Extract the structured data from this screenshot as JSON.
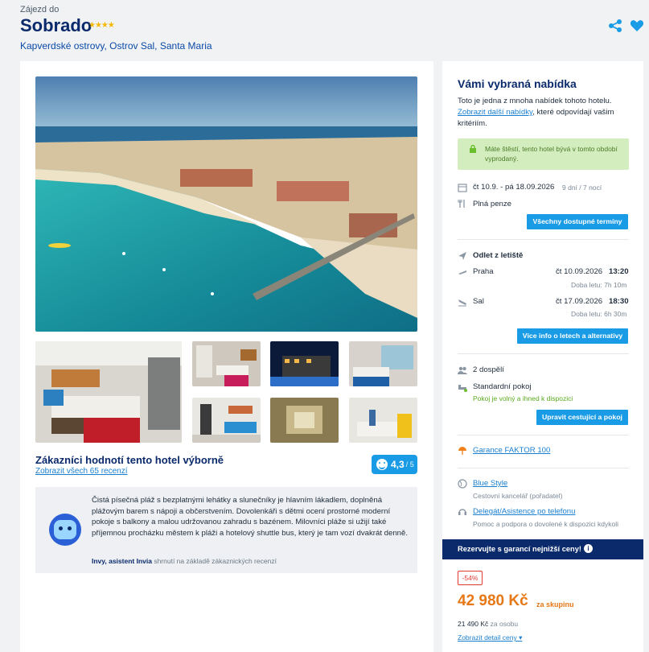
{
  "header": {
    "pretitle": "Zájezd do",
    "hotel_name": "Sobrado",
    "stars": "★★★★",
    "location": "Kapverdské ostrovy, Ostrov Sal, Santa Maria",
    "share_icon": "share-icon",
    "favorite_icon": "heart-icon"
  },
  "gallery": {
    "main_image": "beach-resort-aerial-photo",
    "thumbnails": [
      "hotel-room",
      "room-interior",
      "hotel-night",
      "room-view",
      "room-balcony",
      "bedroom",
      "bathroom",
      "reception"
    ]
  },
  "rating": {
    "title": "Zákazníci hodnotí tento hotel výborně",
    "link": "Zobrazit všech 65 recenzí",
    "value": "4,3",
    "max": "/ 5"
  },
  "ai_summary": {
    "text": "Čistá písečná pláž s bezplatnými lehátky a slunečníky je hlavním lákadlem, doplněná plážovým barem s nápoji a občerstvením. Dovolenkáři s dětmi ocení prostorné moderní pokoje s balkony a malou udržovanou zahradu s bazénem. Milovníci pláže si užijí také příjemnou procházku městem k pláži a hotelový shuttle bus, který je tam vozí dvakrát denně.",
    "author": "Invy, asistent Invia",
    "author_note": " shrnutí na základě zákaznických recenzí"
  },
  "offer": {
    "title": "Vámi vybraná nabídka",
    "desc_1": "Toto je jedna z mnoha nabídek tohoto hotelu.",
    "desc_link": "Zobrazit další nabídky",
    "desc_2": ", které odpovídají vašim kritériím.",
    "alert": "Máte štěstí, tento hotel bývá v tomto období vyprodaný.",
    "dates": "čt 10.9. - pá 18.09.2026",
    "duration": "9 dní / 7 nocí",
    "board": "Plná penze",
    "dates_button": "Všechny dostupné termíny",
    "departure_title": "Odlet z letiště",
    "flight_out_from": "Praha",
    "flight_out_date": "čt 10.09.2026",
    "flight_out_time": "13:20",
    "flight_out_duration": "Doba letu: 7h 10m",
    "flight_back_from": "Sal",
    "flight_back_date": "čt 17.09.2026",
    "flight_back_time": "18:30",
    "flight_back_duration": "Doba letu: 6h 30m",
    "flights_button": "Více info o letech a alternativy",
    "travellers": "2 dospělí",
    "room": "Standardní pokoj",
    "room_status": "Pokoj je volný a ihned k dispozici",
    "room_button": "Upravit cestující a pokoj",
    "guarantee": "Garance FAKTOR 100",
    "blue_style": "Blue Style",
    "blue_style_note": "Cestovní kancelář (pořadatel)",
    "delegate": "Delegát/Asistence po telefonu",
    "delegate_note": "Pomoc a podpora o dovolené k dispozici kdykoli",
    "banner": "Rezervujte s garancí nejnižší ceny!",
    "banner_info": "i",
    "discount": "-54%",
    "price": "42 980 Kč",
    "price_unit": "za skupinu",
    "per_person_value": "21 490 Kč",
    "per_person_label": " za osobu",
    "detail_link": "Zobrazit detail ceny ▾"
  },
  "colors": {
    "brand_dark": "#0a2a6b",
    "brand_blue": "#1a9be6",
    "price_orange": "#e67817",
    "alert_green": "#d4edbe"
  }
}
